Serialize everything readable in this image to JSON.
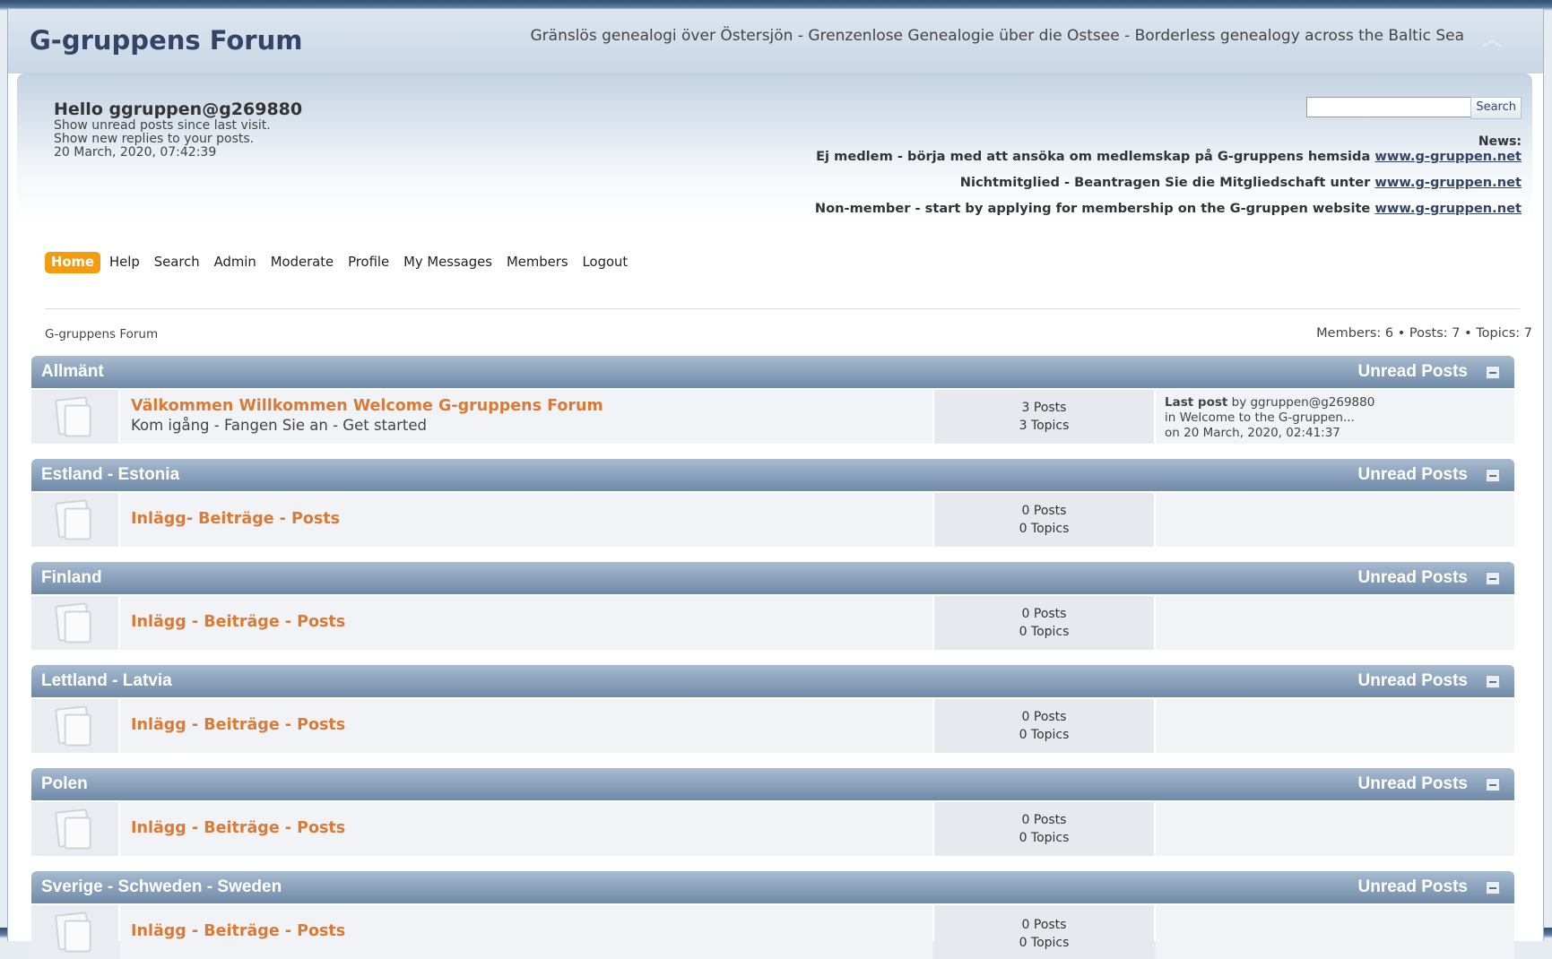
{
  "header": {
    "title": "G-gruppens Forum",
    "tagline": "Gränslös genealogi över Östersjön - Grenzenlose Genealogie über die Ostsee - Borderless genealogy across the Baltic Sea"
  },
  "user": {
    "hello": "Hello ggruppen@g269880",
    "unread_link": "Show unread posts since last visit.",
    "replies_link": "Show new replies to your posts.",
    "datetime": "20 March, 2020, 07:42:39"
  },
  "search": {
    "button_label": "Search",
    "value": ""
  },
  "news": {
    "label": "News:",
    "lines": [
      {
        "text": "Ej medlem - börja med att ansöka om medlemskap på G-gruppens hemsida ",
        "link": "www.g-gruppen.net"
      },
      {
        "text": "Nichtmitglied - Beantragen Sie die Mitgliedschaft unter ",
        "link": "www.g-gruppen.net"
      },
      {
        "text": "Non-member - start by applying for membership on the G-gruppen website ",
        "link": "www.g-gruppen.net"
      }
    ]
  },
  "nav": {
    "items": [
      "Home",
      "Help",
      "Search",
      "Admin",
      "Moderate",
      "Profile",
      "My Messages",
      "Members",
      "Logout"
    ],
    "active": "Home"
  },
  "breadcrumb": "G-gruppens Forum",
  "stats": "Members: 6  •  Posts: 7  •  Topics: 7",
  "categories": [
    {
      "name": "Allmänt",
      "unread": "Unread Posts",
      "board": {
        "title": "Välkommen Willkommen Welcome G-gruppens Forum",
        "description": "Kom igång - Fangen Sie an - Get started",
        "posts": "3 Posts",
        "topics": "3 Topics",
        "last_post_label": "Last post",
        "last_post_by": " by ggruppen@g269880",
        "last_post_in": "in Welcome to the G-gruppen...",
        "last_post_on": "on 20 March, 2020, 02:41:37"
      }
    },
    {
      "name": "Estland - Estonia",
      "unread": "Unread Posts",
      "board": {
        "title": "Inlägg- Beiträge - Posts",
        "posts": "0 Posts",
        "topics": "0 Topics"
      }
    },
    {
      "name": "Finland",
      "unread": "Unread Posts",
      "board": {
        "title": "Inlägg - Beiträge - Posts",
        "posts": "0 Posts",
        "topics": "0 Topics"
      }
    },
    {
      "name": "Lettland - Latvia",
      "unread": "Unread Posts",
      "board": {
        "title": "Inlägg - Beiträge - Posts",
        "posts": "0 Posts",
        "topics": "0 Topics"
      }
    },
    {
      "name": "Polen",
      "unread": "Unread Posts",
      "board": {
        "title": "Inlägg - Beiträge - Posts",
        "posts": "0 Posts",
        "topics": "0 Topics"
      }
    },
    {
      "name": "Sverige - Schweden - Sweden",
      "unread": "Unread Posts",
      "board": {
        "title": "Inlägg - Beiträge - Posts",
        "posts": "0 Posts",
        "topics": "0 Topics"
      }
    }
  ]
}
